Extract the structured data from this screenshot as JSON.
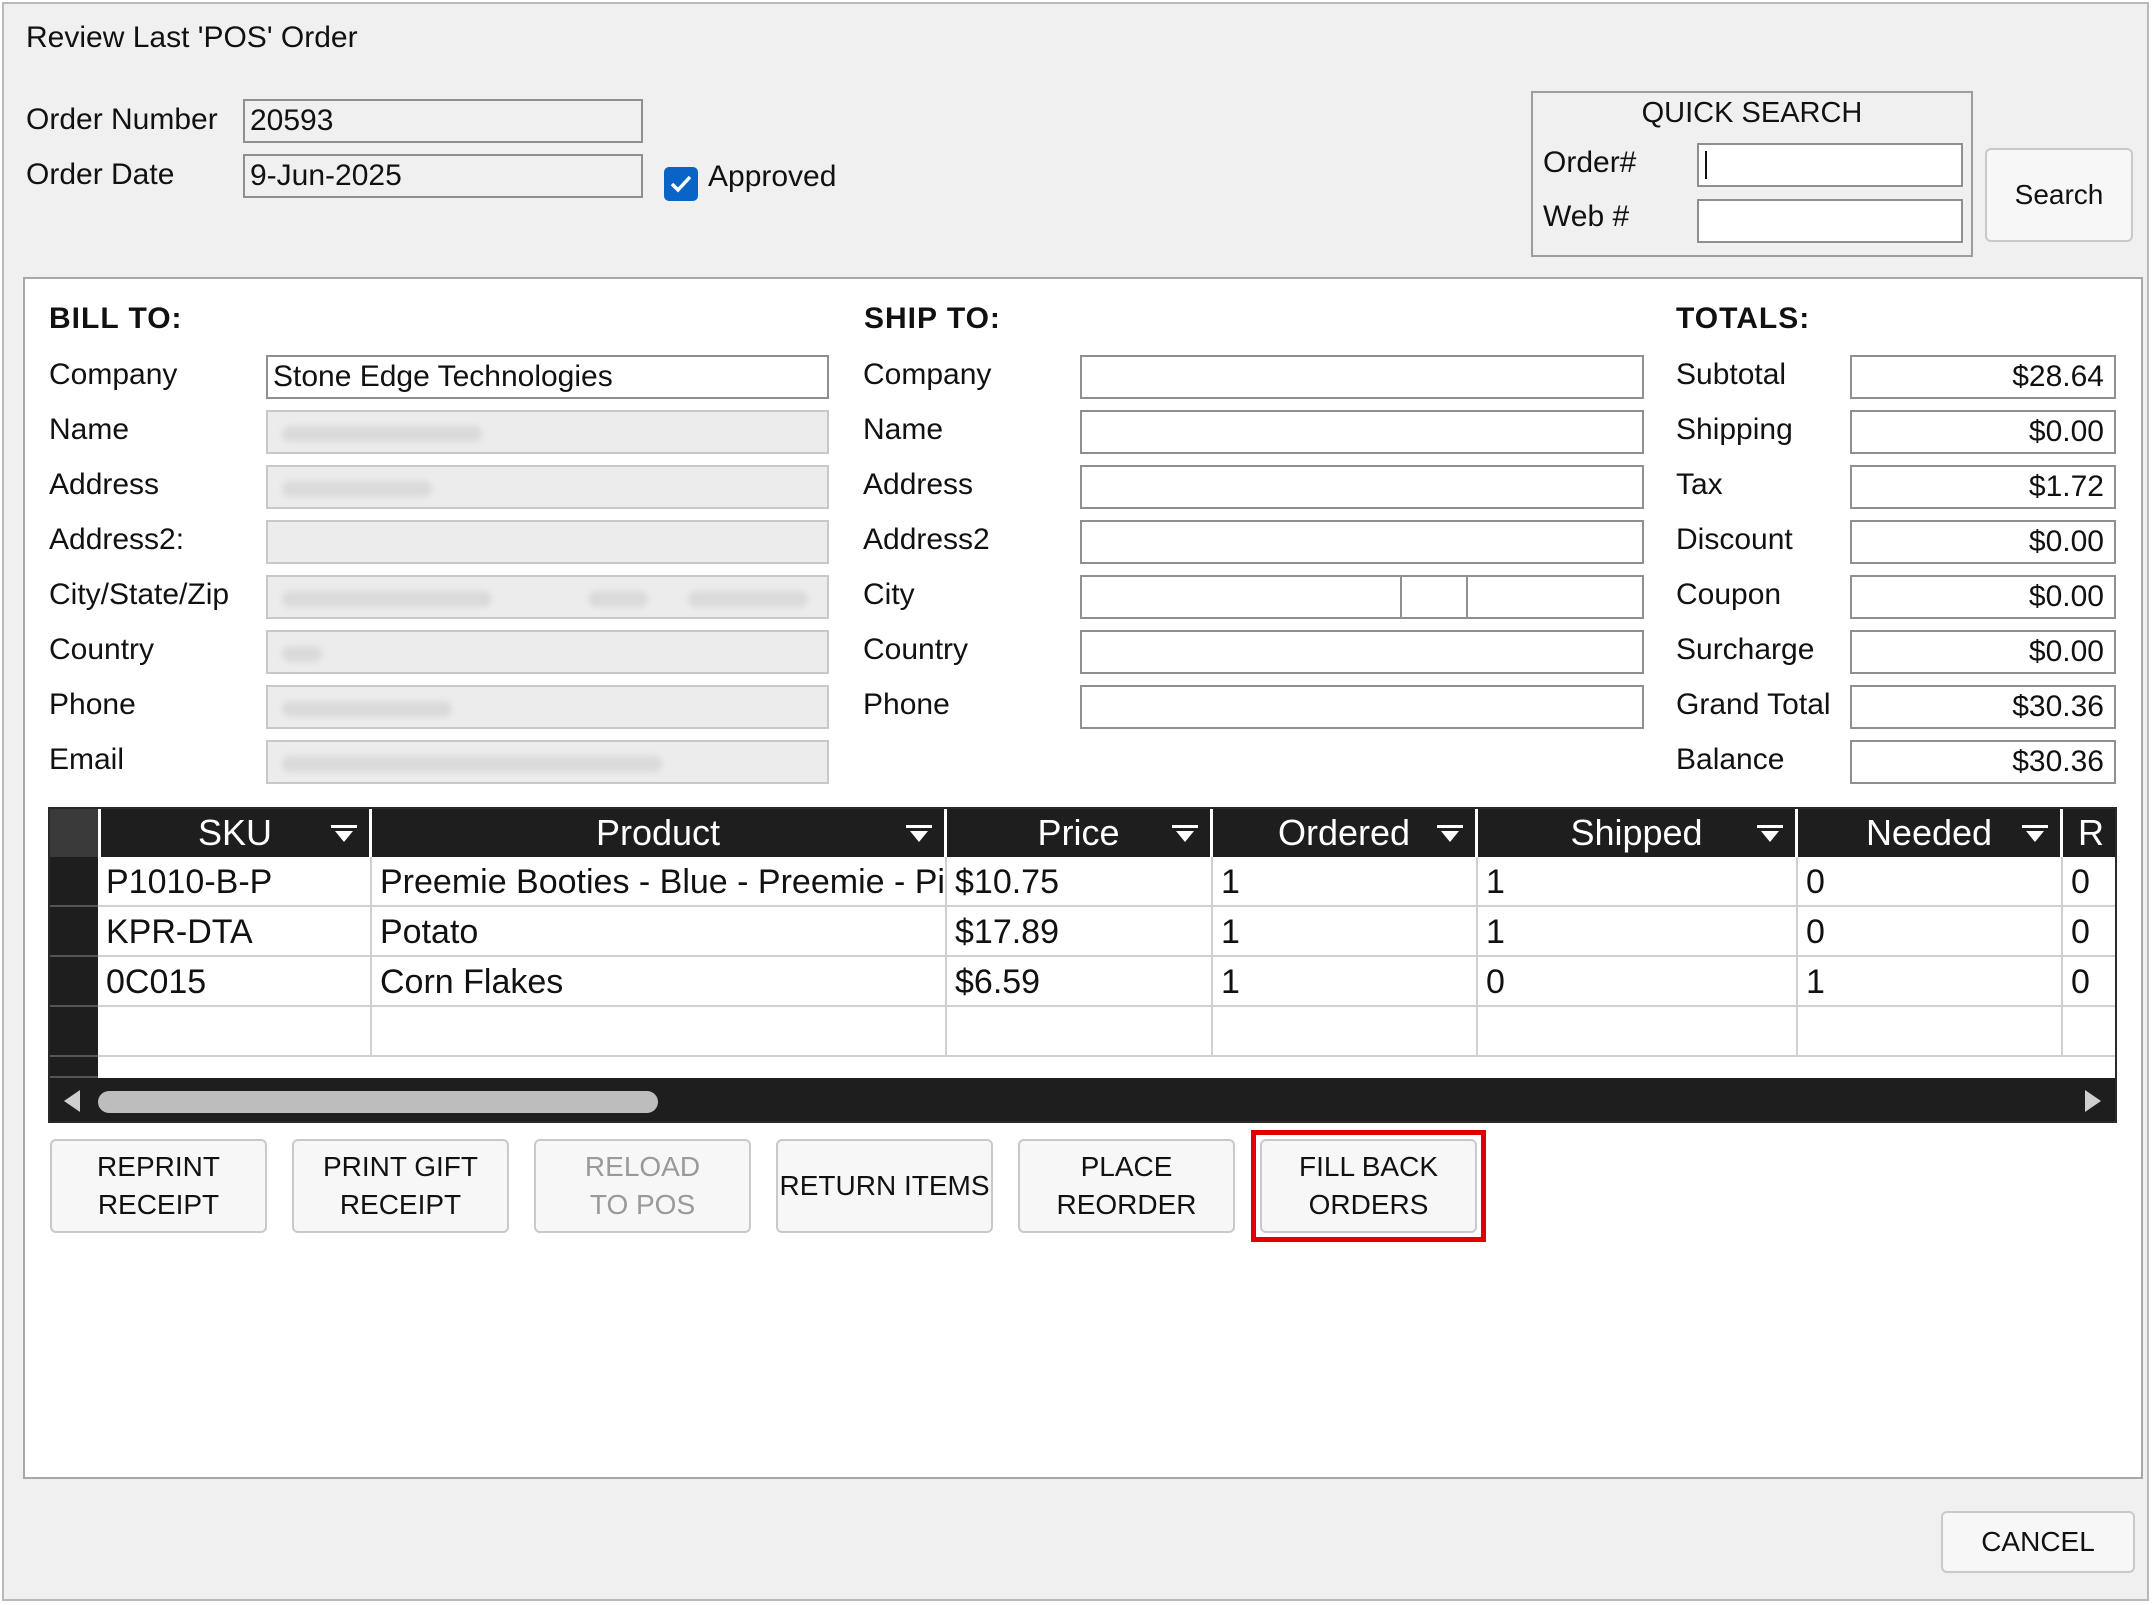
{
  "window": {
    "title": "Review Last 'POS' Order"
  },
  "order": {
    "number_label": "Order Number",
    "number_value": "20593",
    "date_label": "Order Date",
    "date_value": "9-Jun-2025",
    "approved_label": "Approved",
    "approved_checked": true
  },
  "quick_search": {
    "title": "QUICK SEARCH",
    "order_label": "Order#",
    "order_value": "",
    "web_label": "Web #",
    "web_value": "",
    "search_button": "Search"
  },
  "bill_to": {
    "title": "BILL TO:",
    "labels": [
      "Company",
      "Name",
      "Address",
      "Address2:",
      "City/State/Zip",
      "Country",
      "Phone",
      "Email"
    ],
    "company_value": "Stone Edge Technologies"
  },
  "ship_to": {
    "title": "SHIP TO:",
    "labels": [
      "Company",
      "Name",
      "Address",
      "Address2",
      "City",
      "Country",
      "Phone"
    ]
  },
  "totals": {
    "title": "TOTALS:",
    "rows": [
      {
        "label": "Subtotal",
        "value": "$28.64"
      },
      {
        "label": "Shipping",
        "value": "$0.00"
      },
      {
        "label": "Tax",
        "value": "$1.72"
      },
      {
        "label": "Discount",
        "value": "$0.00"
      },
      {
        "label": "Coupon",
        "value": "$0.00"
      },
      {
        "label": "Surcharge",
        "value": "$0.00"
      },
      {
        "label": "Grand Total",
        "value": "$30.36"
      },
      {
        "label": "Balance",
        "value": "$30.36"
      }
    ]
  },
  "grid": {
    "columns": [
      "SKU",
      "Product",
      "Price",
      "Ordered",
      "Shipped",
      "Needed",
      "R"
    ],
    "rows": [
      [
        "P1010-B-P",
        "Preemie Booties - Blue - Preemie - Pink",
        "$10.75",
        "1",
        "1",
        "0",
        "0"
      ],
      [
        "KPR-DTA",
        "Potato",
        "$17.89",
        "1",
        "1",
        "0",
        "0"
      ],
      [
        "0C015",
        "Corn Flakes",
        "$6.59",
        "1",
        "0",
        "1",
        "0"
      ]
    ]
  },
  "actions": {
    "reprint_1": "REPRINT",
    "reprint_2": "RECEIPT",
    "gift_1": "PRINT GIFT",
    "gift_2": "RECEIPT",
    "reload_1": "RELOAD",
    "reload_2": "TO POS",
    "return_items": "RETURN ITEMS",
    "reorder_1": "PLACE",
    "reorder_2": "REORDER",
    "backorder_1": "FILL BACK",
    "backorder_2": "ORDERS",
    "cancel": "CANCEL"
  },
  "colors": {
    "highlight": "#e00000",
    "checkbox": "#0a64c8",
    "grid_header": "#1e1e1e"
  }
}
